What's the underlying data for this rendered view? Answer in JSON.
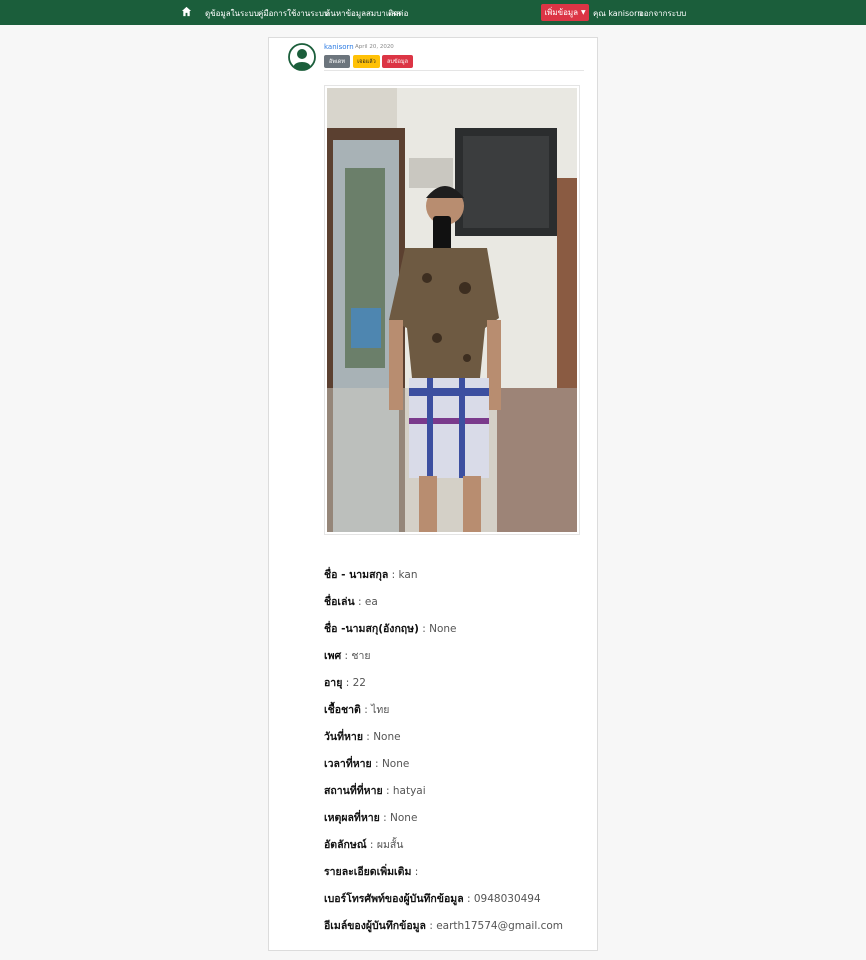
{
  "nav": {
    "home_icon": "home-icon",
    "links": [
      "ดูข้อมูลในระบบ",
      "คู่มือการใช้งานระบบ",
      "ค้นหาข้อมูลสมบาแสส",
      "ติดต่อ"
    ],
    "add_button": "เพิ่มข้อมูล",
    "user": "คุณ kanisorn",
    "logout": "ออกจากระบบ",
    "colors": {
      "navbar": "#1b5e3b",
      "add_button": "#dc3545"
    }
  },
  "post": {
    "avatar_icon": "user-circle-icon",
    "author": "kanisorn",
    "date": "April 20, 2020",
    "actions": {
      "edit": "อัพเดท",
      "found": "เจอแล้ว",
      "delete": "ลบข้อมูล"
    },
    "details": [
      {
        "label": "ชื่อ - นามสกุล",
        "value": "kan"
      },
      {
        "label": "ชื่อเล่น",
        "value": "ea"
      },
      {
        "label": "ชื่อ -นามสกุ(อังกฤษ)",
        "value": "None"
      },
      {
        "label": "เพศ",
        "value": "ชาย"
      },
      {
        "label": "อายุ",
        "value": "22"
      },
      {
        "label": "เชื้อชาติ",
        "value": "ไทย"
      },
      {
        "label": "วันที่หาย",
        "value": "None"
      },
      {
        "label": "เวลาที่หาย",
        "value": "None"
      },
      {
        "label": "สถานที่ที่หาย",
        "value": "hatyai"
      },
      {
        "label": "เหตุผลที่หาย",
        "value": "None"
      },
      {
        "label": "อัตลักษณ์",
        "value": "ผมสั้น"
      },
      {
        "label": "รายละเอียดเพิ่มเติม",
        "value": ""
      },
      {
        "label": "เบอร์โทรศัพท์ของผู้บันทึกข้อมูล",
        "value": "0948030494"
      },
      {
        "label": "อีเมล์ของผู้บันทึกข้อมูล",
        "value": "earth17574@gmail.com"
      }
    ]
  }
}
